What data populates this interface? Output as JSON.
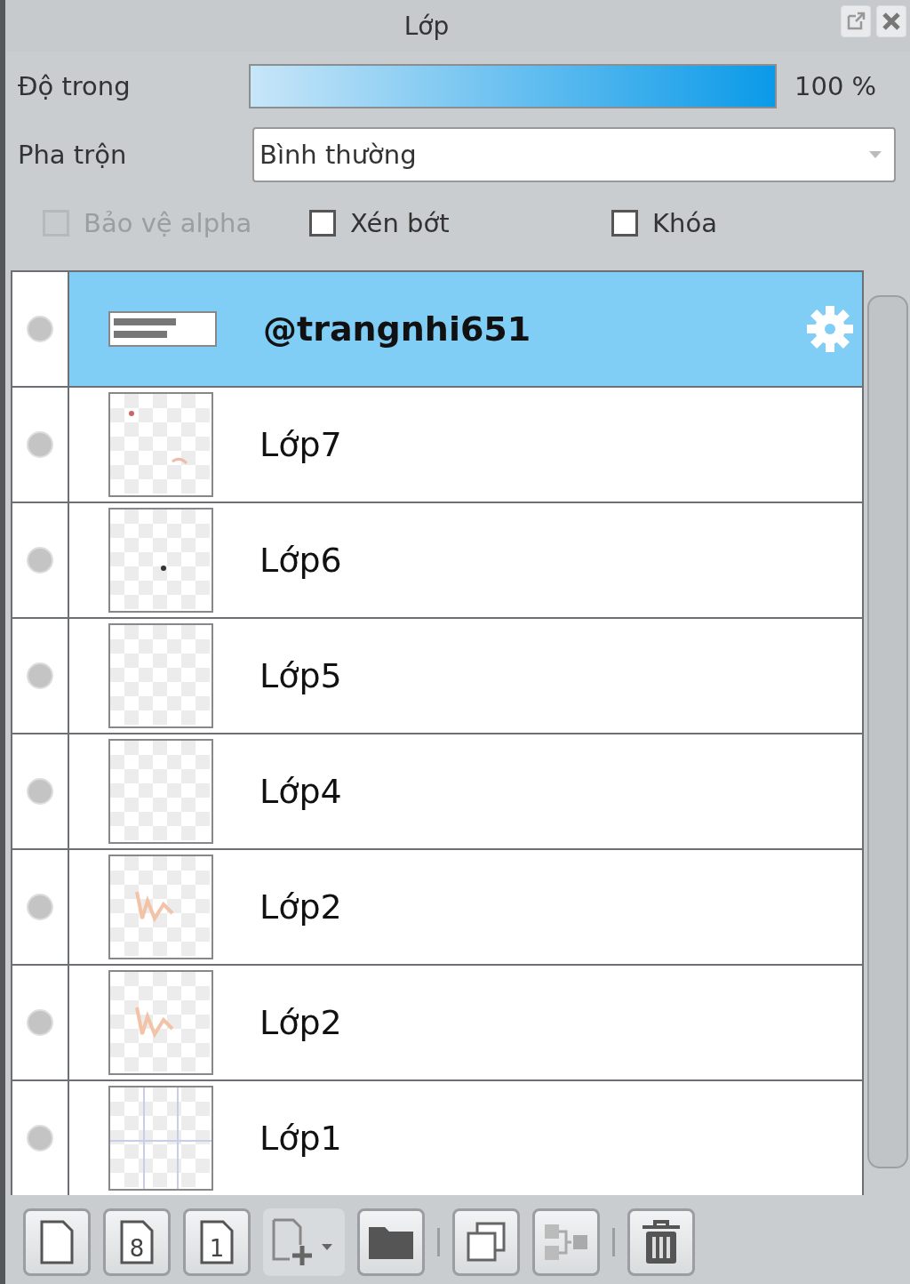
{
  "window": {
    "title": "Lớp"
  },
  "opacity": {
    "label": "Độ trong",
    "level": 1.0,
    "reading": "100 %"
  },
  "blend": {
    "label": "Pha trộn",
    "value": "Bình thường"
  },
  "options": [
    {
      "label": "Bảo vệ alpha",
      "checked": false,
      "disabled": true
    },
    {
      "label": "Xén bớt",
      "checked": false,
      "disabled": false
    },
    {
      "label": "Khóa",
      "checked": false,
      "disabled": false
    }
  ],
  "layers": [
    {
      "name": "@trangnhi651",
      "selected": true
    },
    {
      "name": "Lớp7",
      "selected": false
    },
    {
      "name": "Lớp6",
      "selected": false
    },
    {
      "name": "Lớp5",
      "selected": false
    },
    {
      "name": "Lớp4",
      "selected": false
    },
    {
      "name": "Lớp2",
      "selected": false
    },
    {
      "name": "Lớp2",
      "selected": false
    },
    {
      "name": "Lớp1",
      "selected": false
    }
  ],
  "toolbar": [
    {
      "kind": "new"
    },
    {
      "kind": "numbered",
      "glyph": "8"
    },
    {
      "kind": "numbered",
      "glyph": "1"
    },
    {
      "kind": "add-menu"
    },
    {
      "kind": "folder"
    },
    {
      "kind": "separator"
    },
    {
      "kind": "duplicate"
    },
    {
      "kind": "merge"
    },
    {
      "kind": "separator"
    },
    {
      "kind": "delete"
    }
  ]
}
